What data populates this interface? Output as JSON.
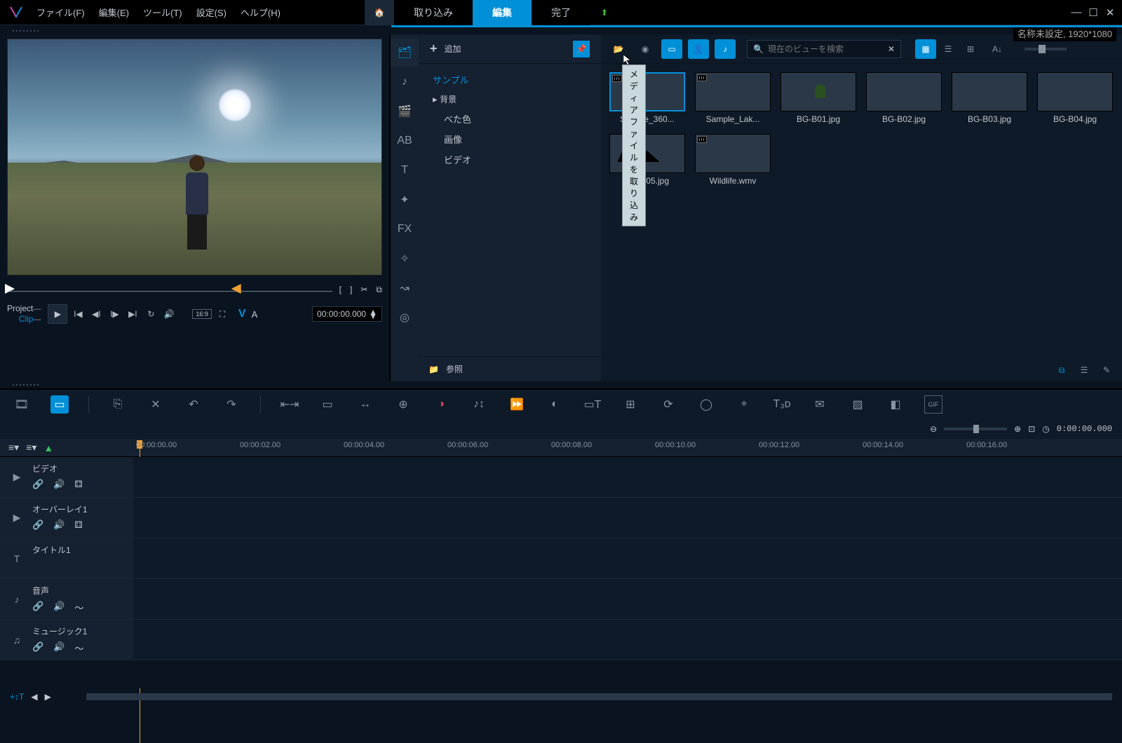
{
  "menu": {
    "file": "ファイル(F)",
    "edit": "編集(E)",
    "tools": "ツール(T)",
    "settings": "設定(S)",
    "help": "ヘルプ(H)"
  },
  "steps": {
    "capture": "取り込み",
    "edit": "編集",
    "share": "完了"
  },
  "project_info": "名称未設定, 1920*1080",
  "preview": {
    "project_label": "Project",
    "clip_label": "Clip",
    "ratio": "16:9",
    "timecode": "00:00:00.000"
  },
  "library": {
    "add": "追加",
    "browse": "参照",
    "tooltip": "メディアファイルを取り込み",
    "search_placeholder": "現在のビューを検索",
    "tree": {
      "sample": "サンプル",
      "background": "背景",
      "solid": "べた色",
      "image": "画像",
      "video": "ビデオ"
    },
    "items": [
      {
        "name": "Sample_360...",
        "cls": "t-sky",
        "vid": true,
        "sel": true
      },
      {
        "name": "Sample_Lak...",
        "cls": "t-lake",
        "vid": true
      },
      {
        "name": "BG-B01.jpg",
        "cls": "t-green"
      },
      {
        "name": "BG-B02.jpg",
        "cls": "t-blue"
      },
      {
        "name": "BG-B03.jpg",
        "cls": "t-sunset"
      },
      {
        "name": "BG-B04.jpg",
        "cls": "t-desert"
      },
      {
        "name": "BG-B05.jpg",
        "cls": "t-red"
      },
      {
        "name": "Wildlife.wmv",
        "cls": "t-black",
        "vid": true
      }
    ]
  },
  "timeline": {
    "zoom_tc": "0:00:00.000",
    "ticks": [
      "00:00:00.00",
      "00:00:02.00",
      "00:00:04.00",
      "00:00:06.00",
      "00:00:08.00",
      "00:00:10.00",
      "00:00:12.00",
      "00:00:14.00",
      "00:00:16.00"
    ],
    "tracks": [
      {
        "icon": "▶",
        "name": "ビデオ",
        "ctrls": [
          "🔗",
          "🔊",
          "⚃"
        ]
      },
      {
        "icon": "▶",
        "name": "オーバーレイ1",
        "ctrls": [
          "🔗",
          "🔊",
          "⚃"
        ]
      },
      {
        "icon": "T",
        "name": "タイトル1",
        "ctrls": []
      },
      {
        "icon": "♪",
        "name": "音声",
        "ctrls": [
          "🔗",
          "🔊",
          "～"
        ]
      },
      {
        "icon": "♫",
        "name": "ミュージック1",
        "ctrls": [
          "🔗",
          "🔊",
          "～"
        ]
      }
    ],
    "add_track": "+↕T"
  }
}
